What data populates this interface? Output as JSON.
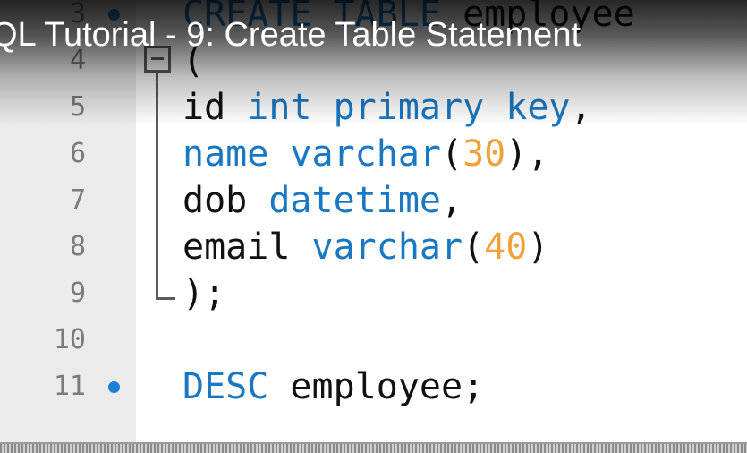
{
  "video": {
    "title": "QL Tutorial - 9: Create Table Statement"
  },
  "editor": {
    "lines": [
      {
        "number": "3",
        "breakpoint": true,
        "tokens": [
          {
            "text": "CREATE TABLE",
            "kind": "keyword"
          },
          {
            "text": " employee",
            "kind": "plain"
          }
        ]
      },
      {
        "number": "4",
        "breakpoint": false,
        "fold": "start",
        "tokens": [
          {
            "text": "(",
            "kind": "plain"
          }
        ]
      },
      {
        "number": "5",
        "breakpoint": false,
        "tokens": [
          {
            "text": "id ",
            "kind": "plain"
          },
          {
            "text": "int primary key",
            "kind": "keyword"
          },
          {
            "text": ",",
            "kind": "plain"
          }
        ]
      },
      {
        "number": "6",
        "breakpoint": false,
        "tokens": [
          {
            "text": "name ",
            "kind": "keyword"
          },
          {
            "text": "varchar",
            "kind": "keyword"
          },
          {
            "text": "(",
            "kind": "plain"
          },
          {
            "text": "30",
            "kind": "number"
          },
          {
            "text": "),",
            "kind": "plain"
          }
        ]
      },
      {
        "number": "7",
        "breakpoint": false,
        "tokens": [
          {
            "text": "dob ",
            "kind": "plain"
          },
          {
            "text": "datetime",
            "kind": "keyword"
          },
          {
            "text": ",",
            "kind": "plain"
          }
        ]
      },
      {
        "number": "8",
        "breakpoint": false,
        "tokens": [
          {
            "text": "email ",
            "kind": "plain"
          },
          {
            "text": "varchar",
            "kind": "keyword"
          },
          {
            "text": "(",
            "kind": "plain"
          },
          {
            "text": "40",
            "kind": "number"
          },
          {
            "text": ")",
            "kind": "plain"
          }
        ]
      },
      {
        "number": "9",
        "breakpoint": false,
        "fold": "end",
        "tokens": [
          {
            "text": ");",
            "kind": "plain"
          }
        ]
      },
      {
        "number": "10",
        "breakpoint": false,
        "tokens": []
      },
      {
        "number": "11",
        "breakpoint": true,
        "tokens": [
          {
            "text": "DESC",
            "kind": "keyword"
          },
          {
            "text": " employee;",
            "kind": "plain"
          }
        ]
      }
    ]
  },
  "colors": {
    "keyword": "#1a78c2",
    "number": "#f0a23a",
    "plain": "#111111",
    "breakpoint": "#1f7fd6",
    "gutter": "#ebebeb"
  }
}
